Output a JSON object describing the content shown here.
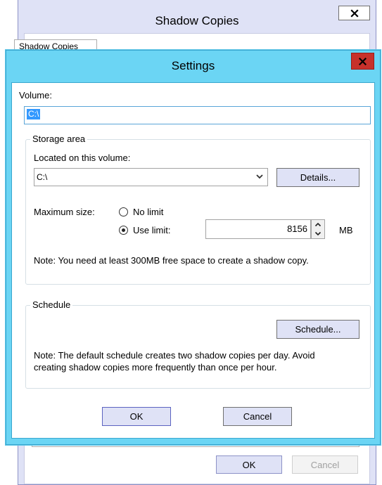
{
  "background_window": {
    "title": "Shadow Copies",
    "close_glyph": "x",
    "tab_label": "Shadow Copies",
    "ok_label": "OK",
    "cancel_label": "Cancel"
  },
  "dialog": {
    "title": "Settings",
    "close_glyph": "x",
    "volume": {
      "label": "Volume:",
      "value": "C:\\"
    },
    "storage_area": {
      "title": "Storage area",
      "located_label": "Located on this volume:",
      "located_value": "C:\\",
      "details_label": "Details...",
      "max_size_label": "Maximum size:",
      "no_limit_label": "No limit",
      "use_limit_label": "Use limit:",
      "selected_option": "use_limit",
      "limit_value": "8156",
      "unit": "MB",
      "note": "Note: You need at least 300MB free space to create a shadow copy."
    },
    "schedule": {
      "title": "Schedule",
      "button_label": "Schedule...",
      "note_line1": "Note: The default schedule creates two shadow copies per day. Avoid",
      "note_line2": "creating shadow copies more frequently than once per hour."
    },
    "ok_label": "OK",
    "cancel_label": "Cancel"
  },
  "icons": {
    "close": "close-icon",
    "dropdown": "chevron-down-icon",
    "spin_up": "spin-up-icon",
    "spin_down": "spin-down-icon"
  },
  "colors": {
    "dialog_frame": "#6bd5f4",
    "close_button": "#c7312b",
    "button_face": "#dfe2f6",
    "selection": "#3399ff"
  }
}
